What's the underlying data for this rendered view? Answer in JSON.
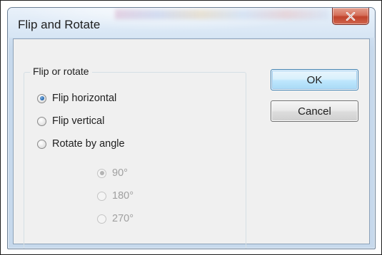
{
  "window": {
    "title": "Flip and Rotate"
  },
  "group": {
    "label": "Flip or rotate",
    "options": [
      {
        "label": "Flip horizontal",
        "checked": true
      },
      {
        "label": "Flip vertical",
        "checked": false
      },
      {
        "label": "Rotate by angle",
        "checked": false
      }
    ],
    "angles": [
      {
        "label": "90°",
        "checked": true,
        "enabled": false
      },
      {
        "label": "180°",
        "checked": false,
        "enabled": false
      },
      {
        "label": "270°",
        "checked": false,
        "enabled": false
      }
    ]
  },
  "buttons": {
    "ok": "OK",
    "cancel": "Cancel"
  },
  "icons": {
    "close": "close-icon",
    "radio": "radio-button-icon"
  },
  "colors": {
    "close_button": "#c7452d",
    "default_button_border": "#3c7fb1",
    "client_background": "#f0f0f0"
  }
}
